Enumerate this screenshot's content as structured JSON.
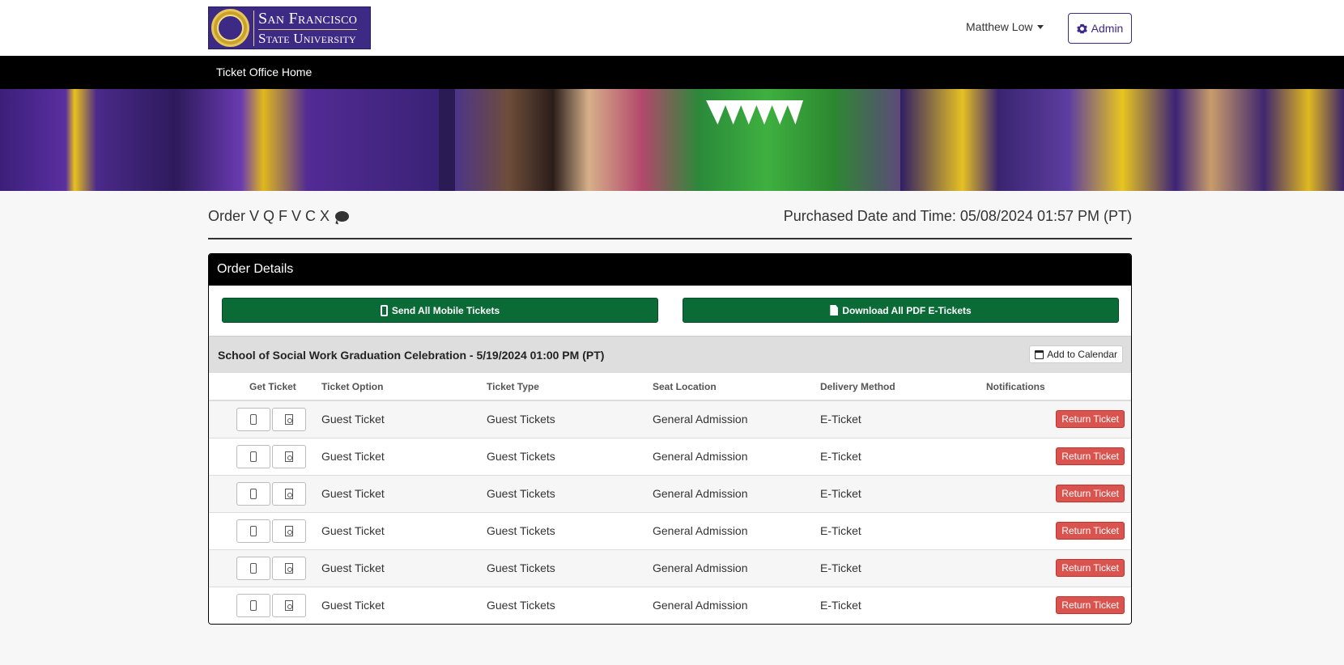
{
  "brand": {
    "line1": "San Francisco",
    "line2": "State University"
  },
  "header": {
    "user_name": "Matthew Low",
    "admin_label": "Admin"
  },
  "nav": {
    "home_label": "Ticket Office Home"
  },
  "order": {
    "title": "Order V Q F V C X",
    "purchased": "Purchased Date and Time: 05/08/2024 01:57 PM (PT)"
  },
  "card": {
    "title": "Order Details",
    "send_mobile_label": "Send All Mobile Tickets",
    "download_pdf_label": "Download All PDF E-Tickets"
  },
  "event": {
    "title": "School of Social Work Graduation Celebration - 5/19/2024 01:00 PM (PT)",
    "calendar_label": "Add to Calendar"
  },
  "columns": [
    "Get Ticket",
    "Ticket Option",
    "Ticket Type",
    "Seat Location",
    "Delivery Method",
    "Notifications"
  ],
  "tickets": [
    {
      "option": "Guest Ticket",
      "type": "Guest Tickets",
      "seat": "General Admission",
      "delivery": "E-Ticket",
      "action": "Return Ticket"
    },
    {
      "option": "Guest Ticket",
      "type": "Guest Tickets",
      "seat": "General Admission",
      "delivery": "E-Ticket",
      "action": "Return Ticket"
    },
    {
      "option": "Guest Ticket",
      "type": "Guest Tickets",
      "seat": "General Admission",
      "delivery": "E-Ticket",
      "action": "Return Ticket"
    },
    {
      "option": "Guest Ticket",
      "type": "Guest Tickets",
      "seat": "General Admission",
      "delivery": "E-Ticket",
      "action": "Return Ticket"
    },
    {
      "option": "Guest Ticket",
      "type": "Guest Tickets",
      "seat": "General Admission",
      "delivery": "E-Ticket",
      "action": "Return Ticket"
    },
    {
      "option": "Guest Ticket",
      "type": "Guest Tickets",
      "seat": "General Admission",
      "delivery": "E-Ticket",
      "action": "Return Ticket"
    }
  ],
  "colors": {
    "brand_purple": "#3c2a84",
    "green": "#0b6b37",
    "danger": "#d9534f"
  },
  "icons": [
    "gear-icon",
    "chat-icon",
    "phone-icon",
    "pdf-icon",
    "calendar-icon",
    "caret-down-icon"
  ]
}
